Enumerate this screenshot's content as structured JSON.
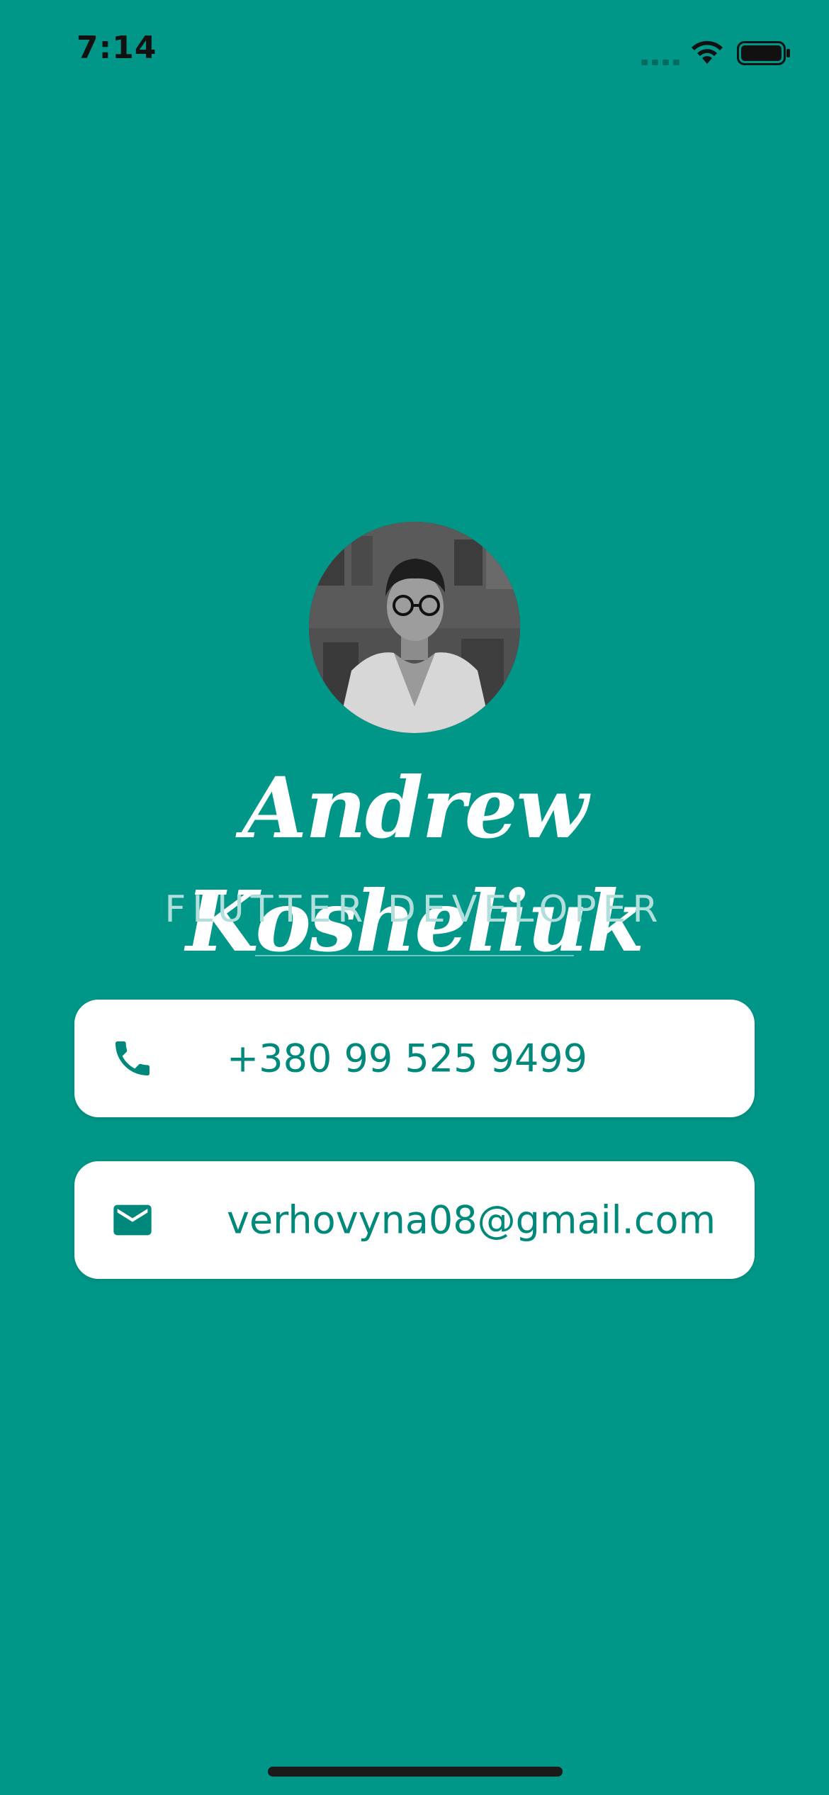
{
  "status_bar": {
    "time": "7:14"
  },
  "profile": {
    "name": "Andrew Kosheliuk",
    "title": "FLUTTER DEVELOPER"
  },
  "contacts": {
    "phone": {
      "icon": "phone-icon",
      "value": "+380 99 525 9499"
    },
    "email": {
      "icon": "email-icon",
      "value": "verhovyna08@gmail.com"
    }
  },
  "colors": {
    "background": "#009688",
    "card_background": "#ffffff",
    "card_text": "#00897b",
    "title_text": "#b2dfdb"
  }
}
